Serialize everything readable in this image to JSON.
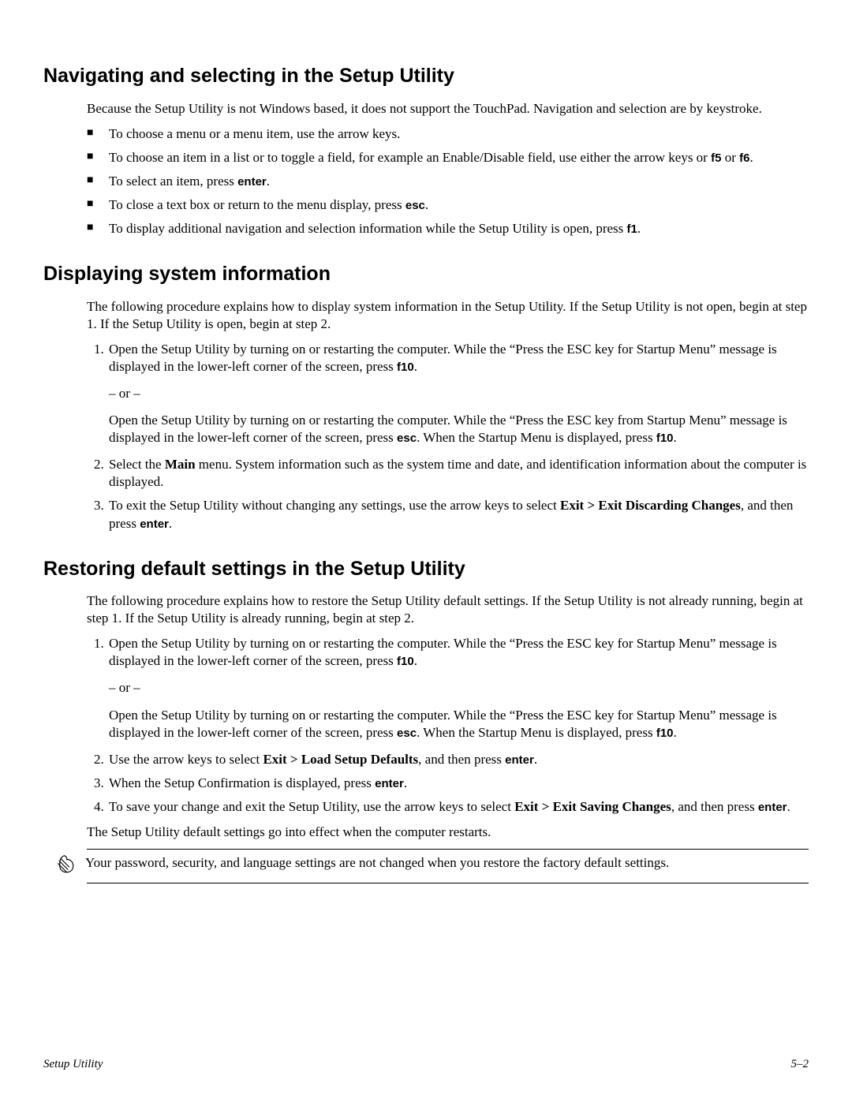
{
  "sections": {
    "s1": {
      "heading": "Navigating and selecting in the Setup Utility",
      "intro": "Because the Setup Utility is not Windows based, it does not support the TouchPad. Navigation and selection are by keystroke.",
      "bullets": {
        "b1": "To choose a menu or a menu item, use the arrow keys.",
        "b2a": "To choose an item in a list or to toggle a field, for example an Enable/Disable field, use either the arrow keys or ",
        "b2_k1": "f5",
        "b2_mid": " or ",
        "b2_k2": "f6",
        "b2_end": ".",
        "b3a": "To select an item, press ",
        "b3_k": "enter",
        "b3_end": ".",
        "b4a": "To close a text box or return to the menu display, press ",
        "b4_k": "esc",
        "b4_end": ".",
        "b5a": "To display additional navigation and selection information while the Setup Utility is open, press ",
        "b5_k": "f1",
        "b5_end": "."
      }
    },
    "s2": {
      "heading": "Displaying system information",
      "intro": "The following procedure explains how to display system information in the Setup Utility. If the Setup Utility is not open, begin at step 1. If the Setup Utility is open, begin at step 2.",
      "steps": {
        "st1a": "Open the Setup Utility by turning on or restarting the computer. While the “Press the ESC key for Startup Menu” message is displayed in the lower-left corner of the screen, press ",
        "st1_k": "f10",
        "st1_end": ".",
        "or": "– or –",
        "st1b_a": "Open the Setup Utility by turning on or restarting the computer. While the “Press the ESC key from Startup Menu” message is displayed in the lower-left corner of the screen, press ",
        "st1b_k1": "esc",
        "st1b_mid": ". When the Startup Menu is displayed, press ",
        "st1b_k2": "f10",
        "st1b_end": ".",
        "st2a": "Select the ",
        "st2_b": "Main",
        "st2_end": " menu. System information such as the system time and date, and identification information about the computer is displayed.",
        "st3a": "To exit the Setup Utility without changing any settings, use the arrow keys to select ",
        "st3_b": "Exit > Exit Discarding Changes",
        "st3_mid": ", and then press ",
        "st3_k": "enter",
        "st3_end": "."
      }
    },
    "s3": {
      "heading": "Restoring default settings in the Setup Utility",
      "intro": "The following procedure explains how to restore the Setup Utility default settings. If the Setup Utility is not already running, begin at step 1. If the Setup Utility is already running, begin at step 2.",
      "steps": {
        "st1a": "Open the Setup Utility by turning on or restarting the computer. While the “Press the ESC key for Startup Menu” message is displayed in the lower-left corner of the screen, press ",
        "st1_k": "f10",
        "st1_end": ".",
        "or": "– or –",
        "st1b_a": "Open the Setup Utility by turning on or restarting the computer. While the “Press the ESC key for Startup Menu” message is displayed in the lower-left corner of the screen, press ",
        "st1b_k1": "esc",
        "st1b_mid": ". When the Startup Menu is displayed, press ",
        "st1b_k2": "f10",
        "st1b_end": ".",
        "st2a": "Use the arrow keys to select ",
        "st2_b": "Exit > Load Setup Defaults",
        "st2_mid": ", and then press ",
        "st2_k": "enter",
        "st2_end": ".",
        "st3a": "When the Setup Confirmation is displayed, press ",
        "st3_k": "enter",
        "st3_end": ".",
        "st4a": "To save your change and exit the Setup Utility, use the arrow keys to select ",
        "st4_b": "Exit > Exit Saving Changes",
        "st4_mid": ", and then press ",
        "st4_k": "enter",
        "st4_end": "."
      },
      "after": "The Setup Utility default settings go into effect when the computer restarts.",
      "note": "Your password, security, and language settings are not changed when you restore the factory default settings."
    }
  },
  "footer": {
    "left": "Setup Utility",
    "right": "5–2"
  }
}
